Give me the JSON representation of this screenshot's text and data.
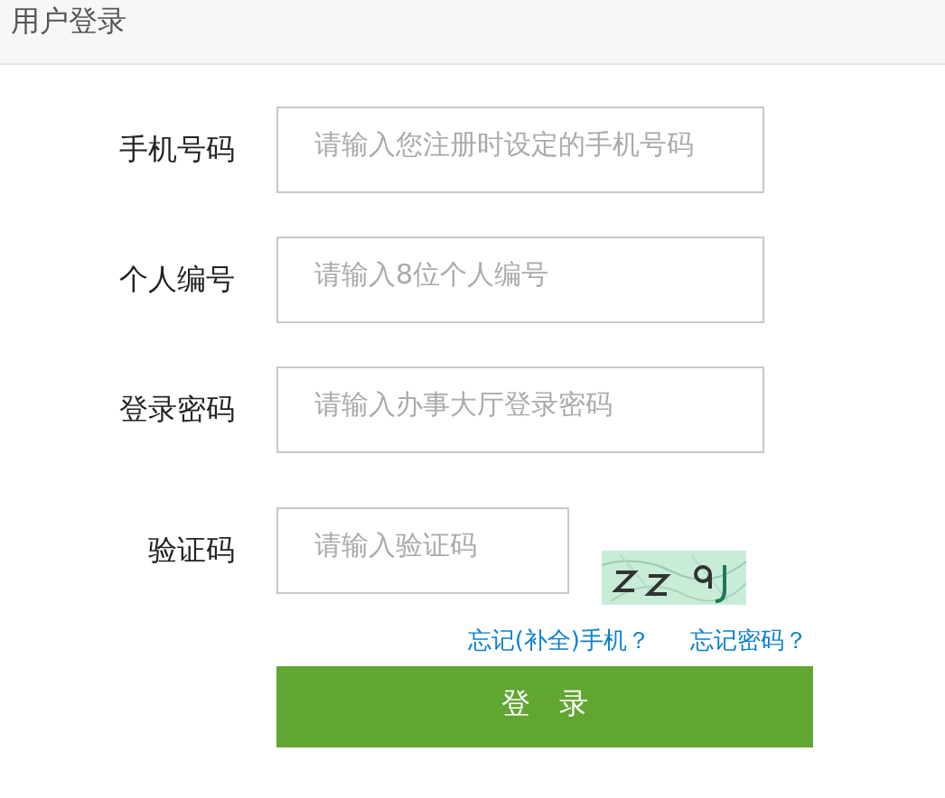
{
  "header": {
    "title": "用户登录"
  },
  "fields": [
    {
      "label": "手机号码",
      "placeholder": "请输入您注册时设定的手机号码",
      "kind": "text"
    },
    {
      "label": "个人编号",
      "placeholder": "请输入8位个人编号",
      "kind": "text"
    },
    {
      "label": "登录密码",
      "placeholder": "请输入办事大厅登录密码",
      "kind": "password"
    },
    {
      "label": "验证码",
      "placeholder": "请输入验证码",
      "kind": "captcha"
    }
  ],
  "links": [
    "忘记(补全)手机？",
    "忘记密码？"
  ],
  "submit": "登　录"
}
